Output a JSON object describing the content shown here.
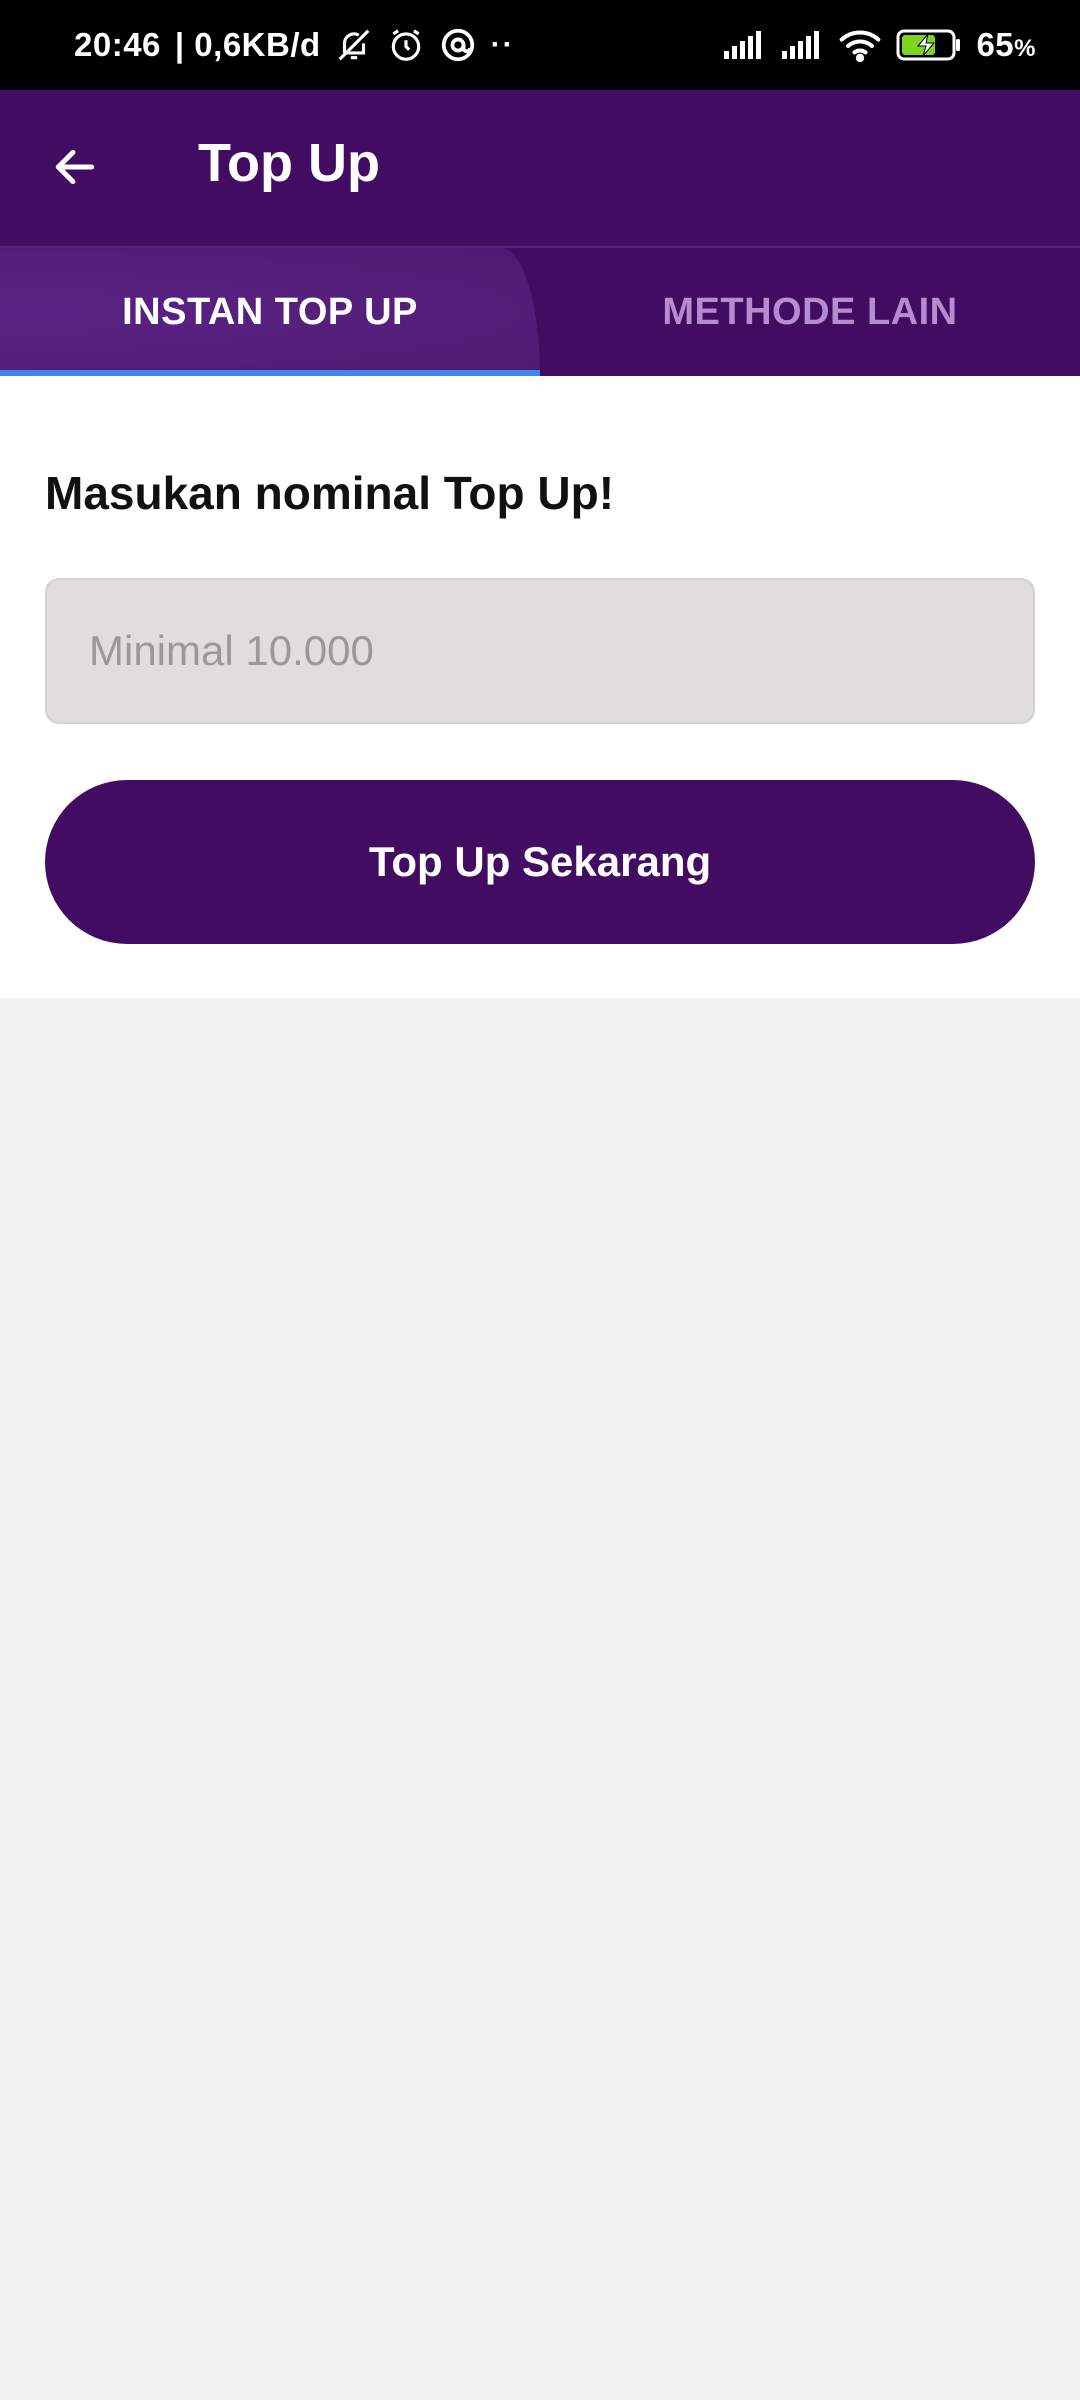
{
  "status_bar": {
    "time": "20:46",
    "network_speed": "| 0,6KB/d",
    "overflow_dots": "··",
    "battery_level": "65",
    "battery_unit": "%"
  },
  "app_bar": {
    "title": "Top Up"
  },
  "tabs": [
    {
      "label": "INSTAN TOP UP",
      "selected": true
    },
    {
      "label": "METHODE LAIN",
      "selected": false
    }
  ],
  "form": {
    "prompt": "Masukan nominal Top Up!",
    "amount_placeholder": "Minimal 10.000",
    "amount_value": "",
    "submit_label": "Top Up Sekarang"
  },
  "colors": {
    "primary": "#420c62",
    "tab_active_bg": "#541e7a",
    "tab_indicator": "#3f86ea",
    "tab_inactive_text": "#b68bd0",
    "input_bg": "#dfdddd",
    "page_bg": "#f1f1f1"
  },
  "icons": {
    "back": "arrow-left-icon",
    "mute": "bell-off-icon",
    "alarm": "alarm-clock-icon",
    "location": "at-sign-icon",
    "signal": "cell-signal-icon",
    "wifi": "wifi-icon",
    "battery": "battery-charging-icon"
  }
}
